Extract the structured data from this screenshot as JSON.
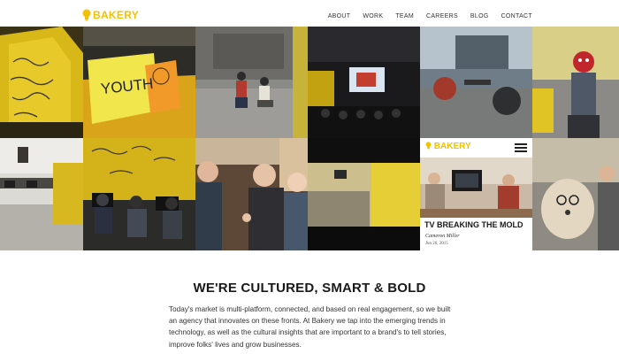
{
  "brand": {
    "name": "BAKERY",
    "color": "#f2c200",
    "icon": "lightbulb-icon"
  },
  "nav": [
    "ABOUT",
    "WORK",
    "TEAM",
    "CAREERS",
    "BLOG",
    "CONTACT"
  ],
  "tiles": [
    {
      "id": "graffiti-office",
      "caption": ""
    },
    {
      "id": "youth-sticky-notes",
      "caption": "YOUTH"
    },
    {
      "id": "studio-floor",
      "caption": ""
    },
    {
      "id": "presentation-room",
      "caption": ""
    },
    {
      "id": "garage-workshop",
      "caption": ""
    },
    {
      "id": "costume-person",
      "caption": ""
    },
    {
      "id": "open-office",
      "caption": ""
    },
    {
      "id": "team-workstations",
      "caption": ""
    },
    {
      "id": "group-conversation",
      "caption": ""
    },
    {
      "id": "lobby",
      "caption": ""
    },
    {
      "id": "blog-post",
      "caption": ""
    },
    {
      "id": "dog-portrait",
      "caption": ""
    }
  ],
  "blog_card": {
    "brand": "BAKERY",
    "title": "TV BREAKING THE MOLD",
    "author": "Cameron Miller",
    "date": "Jun 26, 2015",
    "menu_icon": "hamburger-menu-icon"
  },
  "intro": {
    "heading": "WE'RE CULTURED, SMART & BOLD",
    "body": "Today's market is multi-platform, connected, and based on real engagement, so we built an agency that innovates on these fronts. At Bakery we tap into the emerging trends in technology, as well as the cultural insights that are important to a brand's to tell stories, improve folks' lives and grow businesses."
  }
}
